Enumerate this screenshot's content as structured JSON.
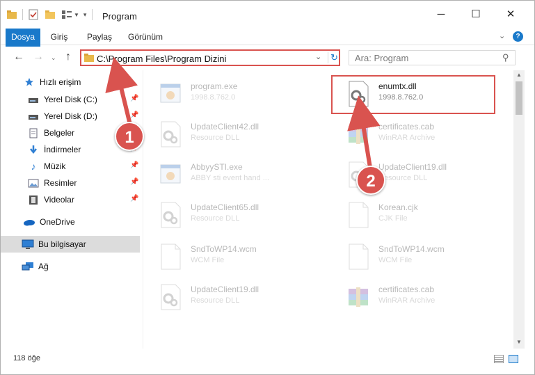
{
  "window": {
    "title": "Program"
  },
  "ribbon": {
    "tabs": [
      "Dosya",
      "Giriş",
      "Paylaş",
      "Görünüm"
    ]
  },
  "nav": {
    "address": "C:\\Program Files\\Program Dizini",
    "search_placeholder": "Ara: Program"
  },
  "sidebar": {
    "items": [
      {
        "label": "Hızlı erişim",
        "icon": "star-icon"
      },
      {
        "label": "Yerel Disk (C:)",
        "icon": "drive-icon"
      },
      {
        "label": "Yerel Disk (D:)",
        "icon": "drive-icon"
      },
      {
        "label": "Belgeler",
        "icon": "document-icon"
      },
      {
        "label": "İndirmeler",
        "icon": "download-icon"
      },
      {
        "label": "Müzik",
        "icon": "music-icon"
      },
      {
        "label": "Resimler",
        "icon": "pictures-icon"
      },
      {
        "label": "Videolar",
        "icon": "video-icon"
      },
      {
        "label": "OneDrive",
        "icon": "cloud-icon"
      },
      {
        "label": "Bu bilgisayar",
        "icon": "computer-icon"
      },
      {
        "label": "Ağ",
        "icon": "network-icon"
      }
    ]
  },
  "files": [
    {
      "name": "program.exe",
      "sub": "1998.8.762.0"
    },
    {
      "name": "enumtx.dll",
      "sub": "1998.8.762.0"
    },
    {
      "name": "UpdateClient42.dll",
      "sub": "Resource DLL"
    },
    {
      "name": "certificates.cab",
      "sub": "WinRAR Archive"
    },
    {
      "name": "AbbyySTI.exe",
      "sub": "ABBY sti event hand ..."
    },
    {
      "name": "UpdateClient19.dll",
      "sub": "Resource DLL"
    },
    {
      "name": "UpdateClient65.dll",
      "sub": "Resource DLL"
    },
    {
      "name": "Korean.cjk",
      "sub": "CJK File"
    },
    {
      "name": "SndToWP14.wcm",
      "sub": "WCM File"
    },
    {
      "name": "SndToWP14.wcm",
      "sub": "WCM File"
    },
    {
      "name": "UpdateClient19.dll",
      "sub": "Resource DLL"
    },
    {
      "name": "certificates.cab",
      "sub": "WinRAR Archive"
    }
  ],
  "status": {
    "count": "118 öğe"
  },
  "annotations": {
    "step1": "1",
    "step2": "2"
  },
  "colors": {
    "accent": "#1979ca",
    "highlight": "#d9534f"
  }
}
